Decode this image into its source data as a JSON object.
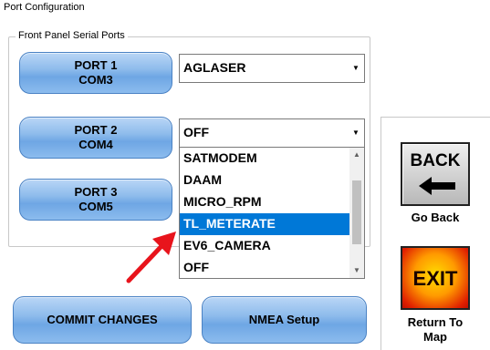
{
  "window": {
    "title": "Port Configuration"
  },
  "group": {
    "legend": "Front Panel Serial Ports"
  },
  "ports": [
    {
      "line1": "PORT 1",
      "line2": "COM3",
      "value": "AGLASER"
    },
    {
      "line1": "PORT 2",
      "line2": "COM4",
      "value": "OFF"
    },
    {
      "line1": "PORT 3",
      "line2": "COM5"
    }
  ],
  "dropdown": {
    "items": [
      "SATMODEM",
      "DAAM",
      "MICRO_RPM",
      "TL_METERATE",
      "EV6_CAMERA",
      "OFF"
    ],
    "selected": "TL_METERATE"
  },
  "buttons": {
    "commit": "COMMIT CHANGES",
    "nmea": "NMEA Setup",
    "back": "BACK",
    "back_caption": "Go Back",
    "exit": "EXIT",
    "exit_caption_1": "Return To",
    "exit_caption_2": "Map"
  },
  "icons": {
    "combo_arrow": "chevron-down-icon",
    "back_arrow": "arrow-left-icon",
    "annotation": "red-arrow-icon"
  },
  "colors": {
    "button_blue": "#8fbcec",
    "selection": "#0078d7",
    "annotation_red": "#e8141c"
  }
}
